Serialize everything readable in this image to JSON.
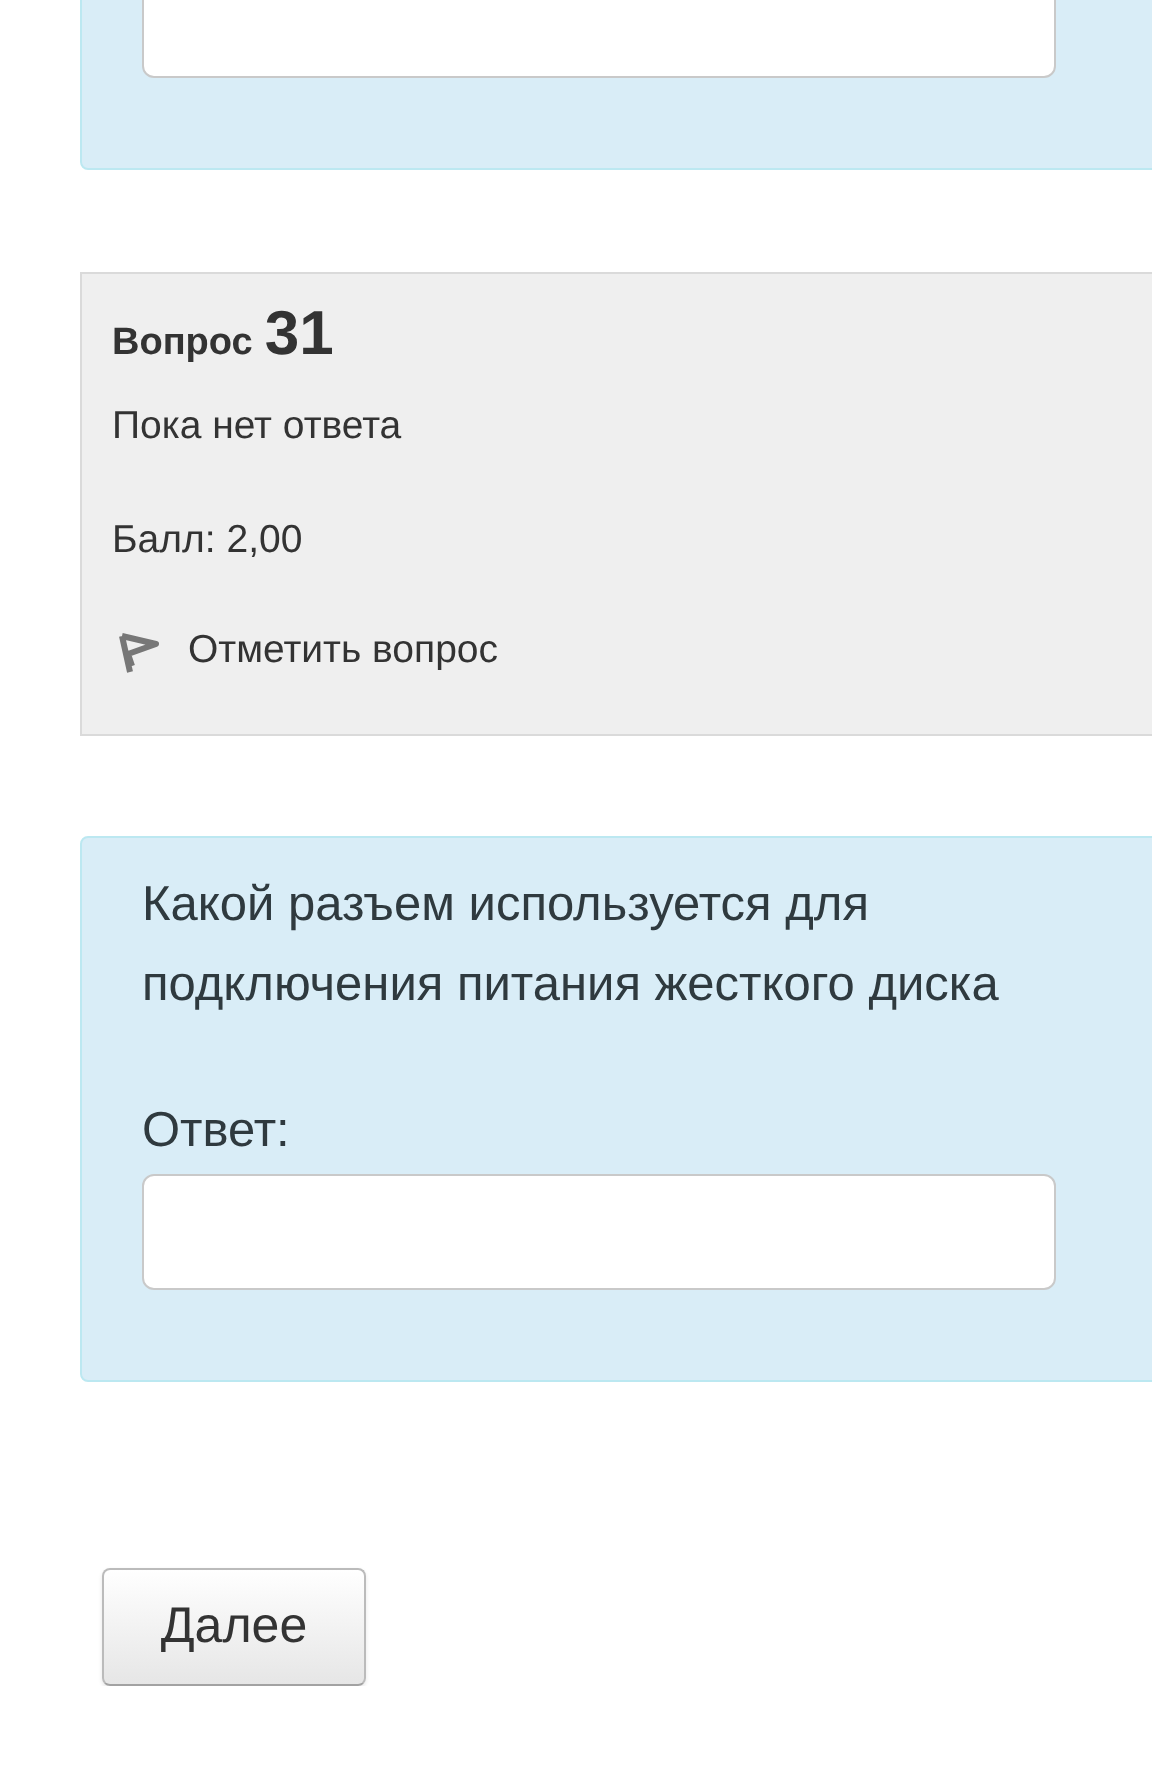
{
  "question_info": {
    "label": "Вопрос",
    "number": "31",
    "status": "Пока нет ответа",
    "mark": "Балл: 2,00",
    "flag_label": "Отметить вопрос",
    "flagged": false
  },
  "question": {
    "text": "Какой разъем используется для подключения питания жесткого диска",
    "answer_label": "Ответ:"
  },
  "next_button": "Далее"
}
